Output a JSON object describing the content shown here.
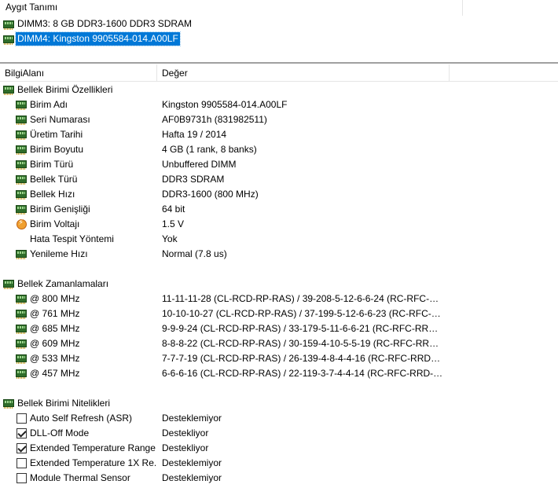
{
  "device_pane": {
    "header": "Aygıt Tanımı",
    "items": [
      {
        "label": "DIMM3: 8 GB DDR3-1600 DDR3 SDRAM",
        "selected": false
      },
      {
        "label": "DIMM4: Kingston 9905584-014.A00LF",
        "selected": true
      }
    ]
  },
  "columns": {
    "field": "BilgiAlanı",
    "value": "Değer"
  },
  "sections": [
    {
      "title": "Bellek Birimi Özellikleri",
      "rows": [
        {
          "key": "Birim Adı",
          "value": "Kingston 9905584-014.A00LF",
          "icon": "ram-icon"
        },
        {
          "key": "Seri Numarası",
          "value": "AF0B9731h (831982511)",
          "icon": "ram-icon"
        },
        {
          "key": "Üretim Tarihi",
          "value": "Hafta 19 / 2014",
          "icon": "ram-icon"
        },
        {
          "key": "Birim Boyutu",
          "value": "4 GB (1 rank, 8 banks)",
          "icon": "ram-icon"
        },
        {
          "key": "Birim Türü",
          "value": "Unbuffered DIMM",
          "icon": "ram-icon"
        },
        {
          "key": "Bellek Türü",
          "value": "DDR3 SDRAM",
          "icon": "ram-icon"
        },
        {
          "key": "Bellek Hızı",
          "value": "DDR3-1600 (800 MHz)",
          "icon": "ram-icon"
        },
        {
          "key": "Birim Genişliği",
          "value": "64 bit",
          "icon": "ram-icon"
        },
        {
          "key": "Birim Voltajı",
          "value": "1.5 V",
          "icon": "voltage-icon"
        },
        {
          "key": "Hata Tespit Yöntemi",
          "value": "Yok",
          "icon": "blank-icon"
        },
        {
          "key": "Yenileme Hızı",
          "value": "Normal (7.8 us)",
          "icon": "ram-icon"
        }
      ]
    },
    {
      "title": "Bellek Zamanlamaları",
      "rows": [
        {
          "key": "@ 800 MHz",
          "value": "11-11-11-28  (CL-RCD-RP-RAS) / 39-208-5-12-6-6-24  (RC-RFC-RR...",
          "icon": "ram-icon"
        },
        {
          "key": "@ 761 MHz",
          "value": "10-10-10-27  (CL-RCD-RP-RAS) / 37-199-5-12-6-6-23  (RC-RFC-RR...",
          "icon": "ram-icon"
        },
        {
          "key": "@ 685 MHz",
          "value": "9-9-9-24  (CL-RCD-RP-RAS) / 33-179-5-11-6-6-21  (RC-RFC-RRD-...",
          "icon": "ram-icon"
        },
        {
          "key": "@ 609 MHz",
          "value": "8-8-8-22  (CL-RCD-RP-RAS) / 30-159-4-10-5-5-19  (RC-RFC-RRD-...",
          "icon": "ram-icon"
        },
        {
          "key": "@ 533 MHz",
          "value": "7-7-7-19  (CL-RCD-RP-RAS) / 26-139-4-8-4-4-16  (RC-RFC-RRD-W...",
          "icon": "ram-icon"
        },
        {
          "key": "@ 457 MHz",
          "value": "6-6-6-16  (CL-RCD-RP-RAS) / 22-119-3-7-4-4-14  (RC-RFC-RRD-W...",
          "icon": "ram-icon"
        }
      ]
    },
    {
      "title": "Bellek Birimi Nitelikleri",
      "rows": [
        {
          "key": "Auto Self Refresh (ASR)",
          "value": "Desteklemiyor",
          "checked": false
        },
        {
          "key": "DLL-Off Mode",
          "value": "Destekliyor",
          "checked": true
        },
        {
          "key": "Extended Temperature Range",
          "value": "Destekliyor",
          "checked": true
        },
        {
          "key": "Extended Temperature 1X Re...",
          "value": "Desteklemiyor",
          "checked": false
        },
        {
          "key": "Module Thermal Sensor",
          "value": "Desteklemiyor",
          "checked": false
        }
      ]
    }
  ]
}
